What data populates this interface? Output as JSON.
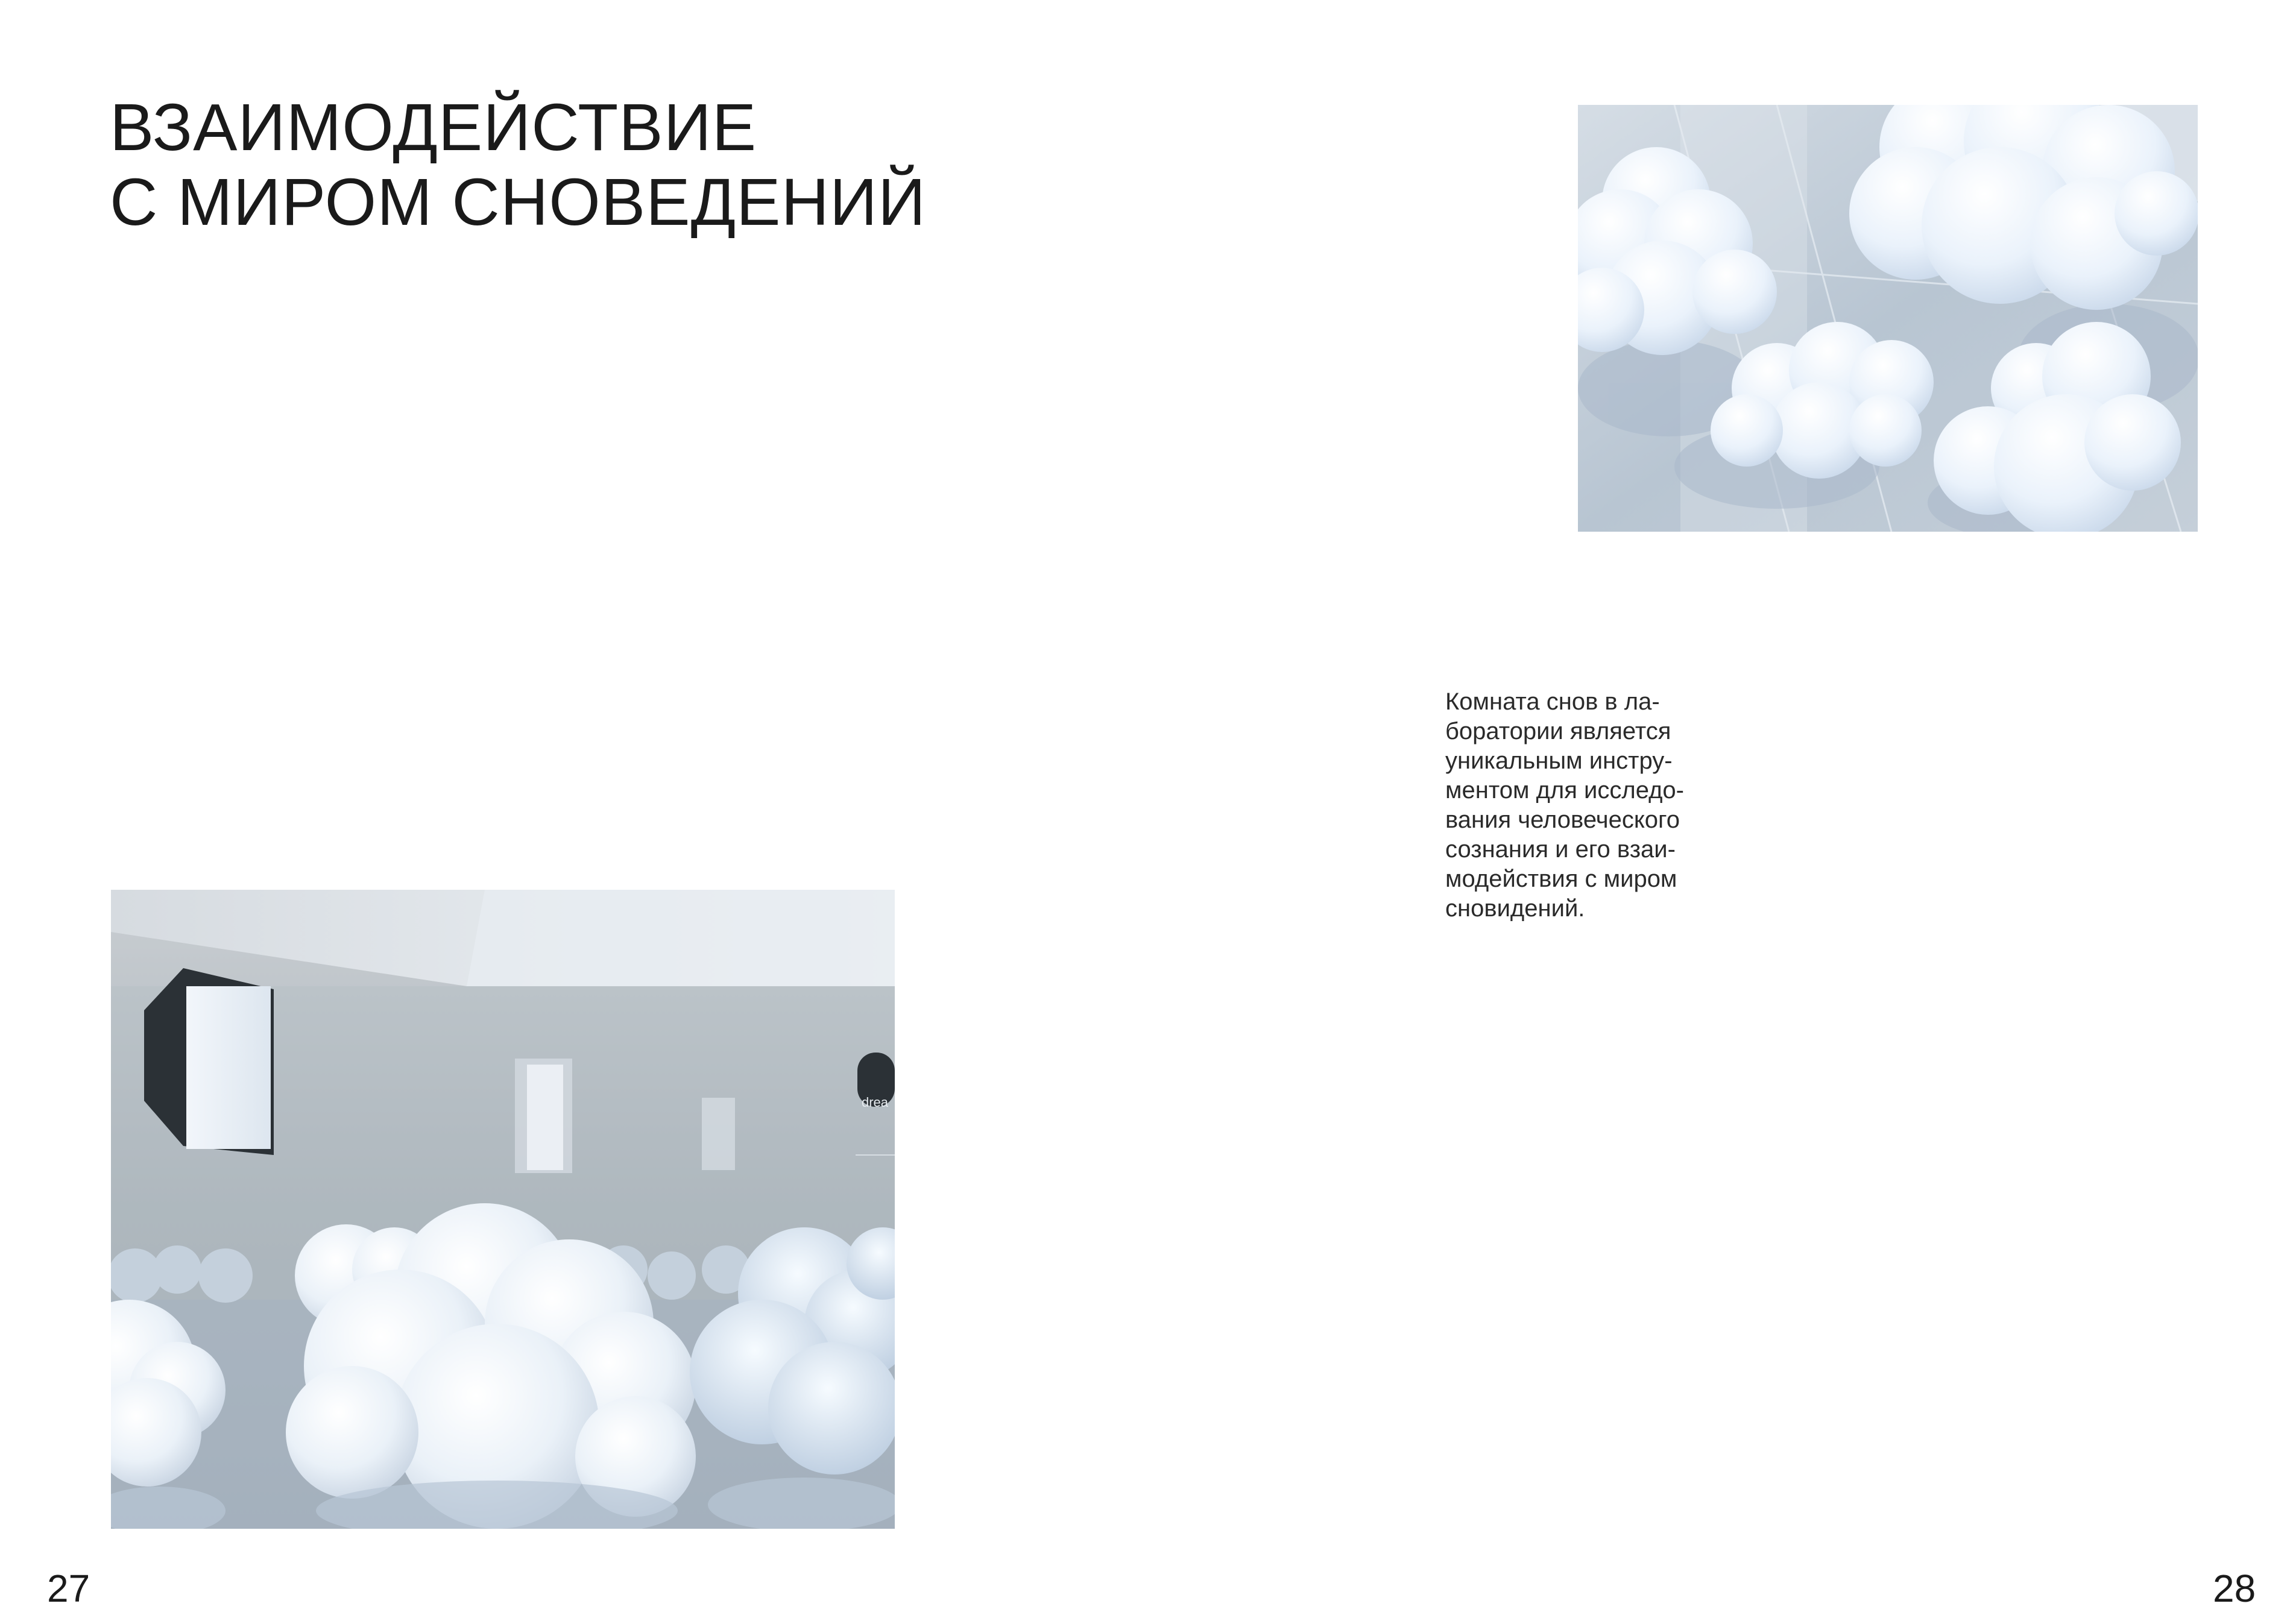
{
  "left_page": {
    "title_lines": [
      "ВЗАИМОДЕЙСТВИЕ",
      "С МИРОМ СНОВЕДЕНИЙ"
    ],
    "image": {
      "subject": "dream-room-clouds-perspective",
      "overlay_text": "drea"
    },
    "page_number": "27"
  },
  "right_page": {
    "image": {
      "subject": "floating-clouds-in-glass-room"
    },
    "body_lines": [
      "Комната снов в ла-",
      "боратории является",
      "уникальным инстру-",
      "ментом для исследо-",
      "вания человеческого",
      "сознания и его взаи-",
      "модействия с миром",
      "сновидений."
    ],
    "page_number": "28"
  }
}
